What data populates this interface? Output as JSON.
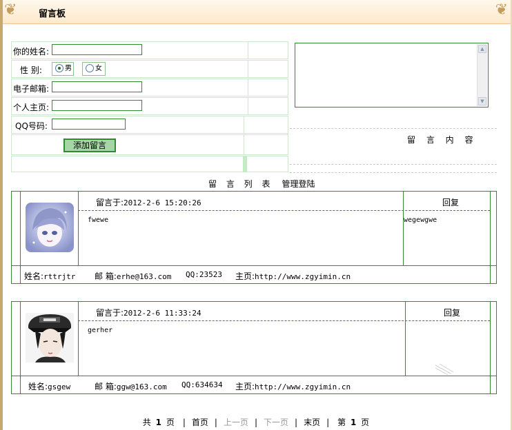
{
  "header": {
    "title": "留言板"
  },
  "form": {
    "name_label": "你的姓名:",
    "gender_label": "性  别:",
    "gender_male": "男",
    "gender_female": "女",
    "email_label": "电子邮箱:",
    "homepage_label": "个人主页:",
    "qq_label": "QQ号码:",
    "submit_label": "添加留言",
    "content_label": "留 言 内 容"
  },
  "list": {
    "title": "留 言 列 表",
    "admin_link": "管理登陆"
  },
  "messages": [
    {
      "time_label": "留言于:",
      "time": "2012-2-6 15:20:26",
      "reply_label": "回复",
      "content": "fwewe",
      "reply_text": "wegewgwe",
      "name_label": "姓名:",
      "name": "rttrjtr",
      "email_label": "邮 箱:",
      "email": "erhe@163.com",
      "qq": "QQ:23523",
      "homepage_label": "主页:",
      "homepage": "http://www.zgyimin.cn",
      "avatar": "anime-girl-avatar"
    },
    {
      "time_label": "留言于:",
      "time": "2012-2-6 11:33:24",
      "reply_label": "回复",
      "content": "gerher",
      "reply_text": "",
      "name_label": "姓名:",
      "name": "gsgew",
      "email_label": "邮 箱:",
      "email": "ggw@163.com",
      "qq": "QQ:634634",
      "homepage_label": "主页:",
      "homepage": "http://www.zgyimin.cn",
      "avatar": "anime-boy-cap-avatar"
    }
  ],
  "pager": {
    "total_prefix": "共",
    "total_pages": "1",
    "page_unit": "页",
    "first": "首页",
    "prev": "上一页",
    "next": "下一页",
    "last": "末页",
    "current_prefix": "第",
    "current": "1",
    "current_suffix": "页"
  }
}
